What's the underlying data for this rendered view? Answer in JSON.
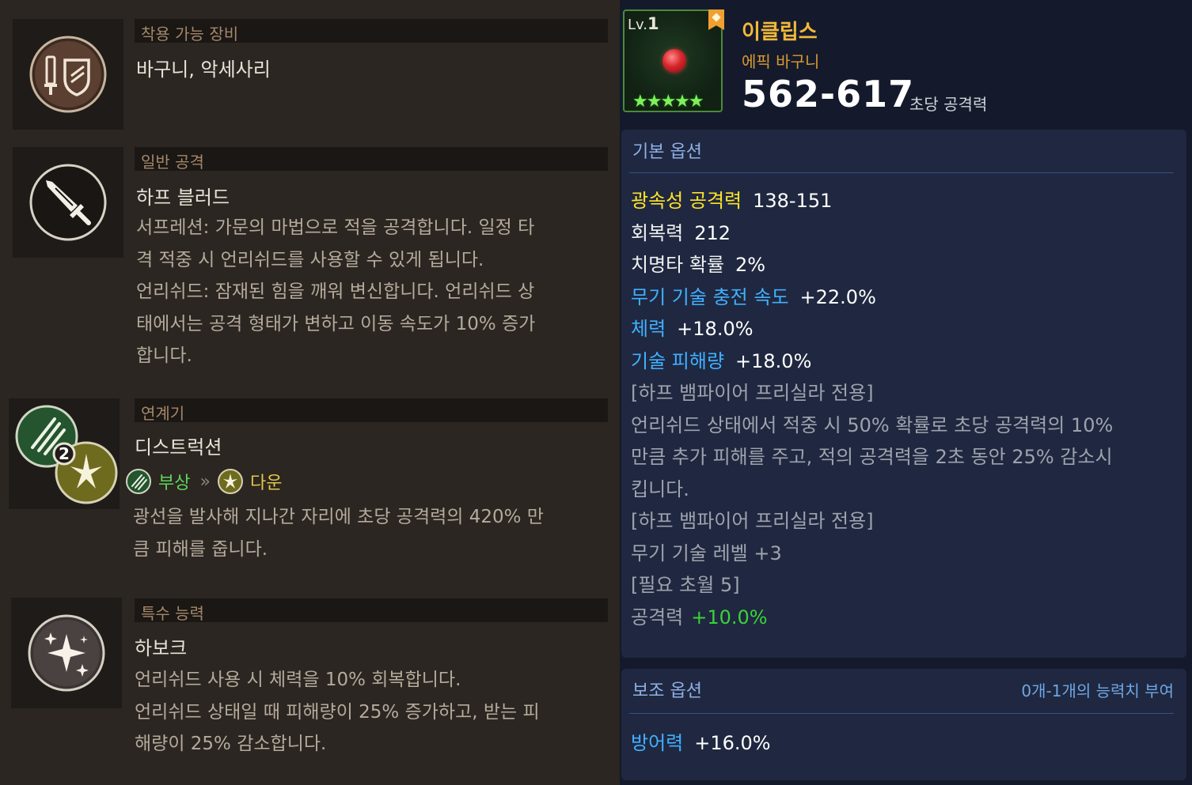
{
  "equip": {
    "header": "착용 가능 장비",
    "title": "바구니, 악세사리",
    "icon": "sword-shield-icon"
  },
  "attack": {
    "header": "일반 공격",
    "title": "하프 블러드",
    "icon": "sword-icon",
    "lines": [
      "서프레션: 가문의 마법으로 적을 공격합니다. 일정 타",
      "격 적중 시 언리쉬드를 사용할 수 있게 됩니다.",
      "언리쉬드: 잠재된 힘을 깨워 변신합니다. 언리쉬드 상",
      "태에서는 공격 형태가 변하고 이동 속도가 10% 증가",
      "합니다."
    ]
  },
  "chain": {
    "header": "연계기",
    "title": "디스트럭션",
    "icon": "claw-burst-chain-icon",
    "from_label": "부상",
    "arrow": "»",
    "to_label": "다운",
    "lines": [
      "광선을 발사해 지나간 자리에 초당 공격력의 420% 만",
      "큼 피해를 줍니다."
    ]
  },
  "special": {
    "header": "특수 능력",
    "title": "하보크",
    "icon": "sparkle-icon",
    "lines": [
      "언리쉬드 사용 시 체력을 10% 회복합니다.",
      "언리쉬드 상태일 때 피해량이 25% 증가하고, 받는 피",
      "해량이 25% 감소합니다."
    ]
  },
  "item": {
    "level_prefix": "Lv.",
    "level": "1",
    "stars": "★★★★★",
    "name": "이클립스",
    "type": "에픽 바구니",
    "dps": "562-617",
    "dps_label": "초당 공격력"
  },
  "basic_options": {
    "header": "기본 옵션",
    "stats": [
      {
        "name": "광속성 공격력",
        "value": "138-151"
      },
      {
        "name": "회복력",
        "value": "212"
      },
      {
        "name": "치명타 확률",
        "value": "2%"
      },
      {
        "name": "무기 기술 충전 속도",
        "value": "+22.0%"
      },
      {
        "name": "체력",
        "value": "+18.0%"
      },
      {
        "name": "기술 피해량",
        "value": "+18.0%"
      }
    ],
    "notes": [
      "[하프 뱀파이어 프리실라 전용]",
      "언리쉬드 상태에서 적중 시 50% 확률로 초당 공격력의 10%",
      "만큼 추가 피해를 주고, 적의 공격력을 2초 동안 25% 감소시",
      "킵니다.",
      "[하프 뱀파이어 프리실라 전용]",
      "무기 기술 레벨 +3",
      "[필요 초월 5]"
    ],
    "bonus": {
      "name": "공격력",
      "value": "+10.0%"
    }
  },
  "sub_options": {
    "header": "보조 옵션",
    "note": "0개-1개의 능력치 부여",
    "stat": {
      "name": "방어력",
      "value": "+16.0%"
    }
  },
  "colors": {
    "stat_yellow": "#ffe22a",
    "stat_blue": "#41b0ff",
    "bonus_green": "#3ad23a",
    "item_name": "#f2b83a",
    "rarity_green": "#4b8a3c"
  }
}
